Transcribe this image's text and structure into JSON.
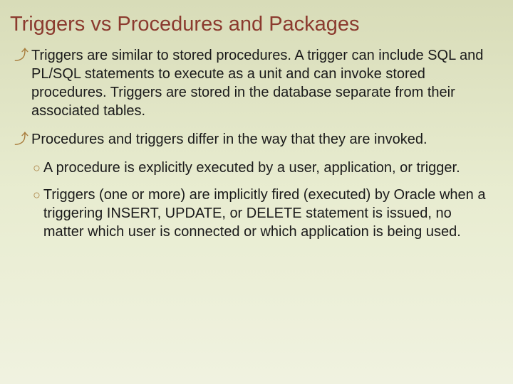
{
  "title": "Triggers vs Procedures and Packages",
  "bullets": [
    {
      "text": "Triggers are similar to stored procedures. A trigger can include SQL and PL/SQL statements to execute as a unit and can invoke stored procedures. Triggers are stored in the database separate from their associated tables."
    },
    {
      "text": "Procedures and triggers differ in the way that they are invoked.",
      "subs": [
        "A procedure is explicitly executed by a user, application, or trigger.",
        "Triggers (one or more) are implicitly fired (executed) by Oracle when a triggering INSERT, UPDATE, or DELETE statement is issued, no matter which user is connected or which application is being used."
      ]
    }
  ],
  "marks": {
    "main": "⤴",
    "sub": "○"
  }
}
